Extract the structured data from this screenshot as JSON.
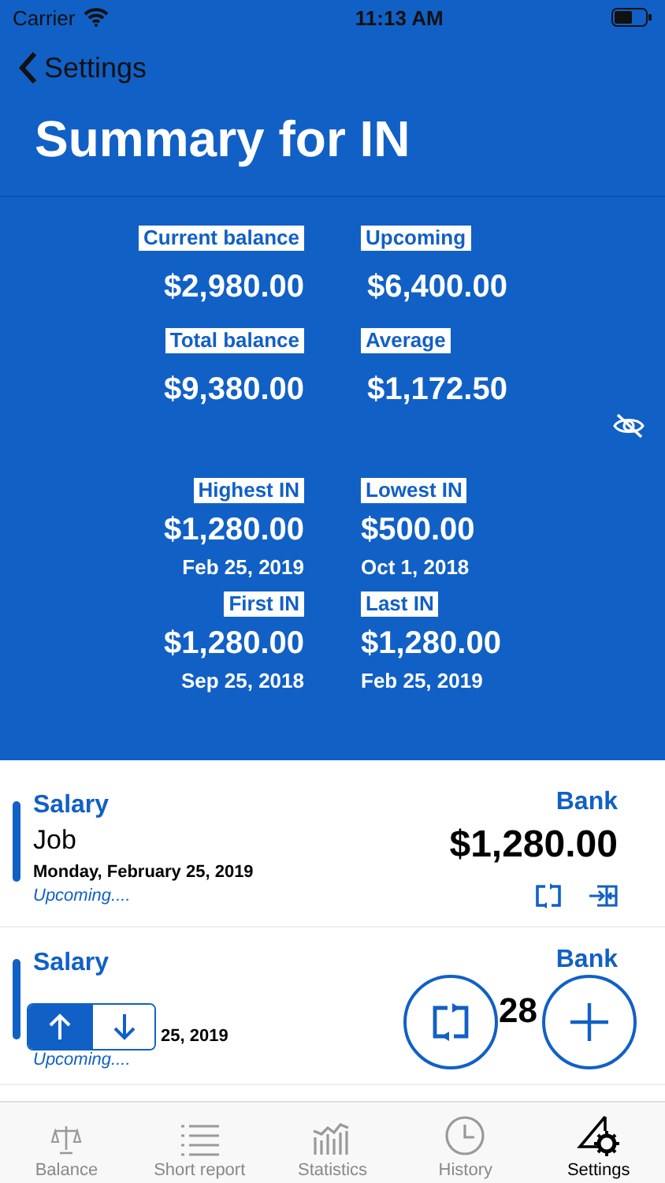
{
  "status_bar": {
    "carrier": "Carrier",
    "time": "11:13 AM"
  },
  "nav": {
    "back": "Settings",
    "title": "Summary for IN"
  },
  "summary_top": [
    {
      "label": "Current balance",
      "value": "$2,980.00"
    },
    {
      "label": "Upcoming",
      "value": "$6,400.00"
    },
    {
      "label": "Total balance",
      "value": "$9,380.00"
    },
    {
      "label": "Average",
      "value": "$1,172.50"
    }
  ],
  "summary_records": [
    {
      "label": "Highest IN",
      "value": "$1,280.00",
      "date": "Feb 25, 2019"
    },
    {
      "label": "Lowest IN",
      "value": "$500.00",
      "date": "Oct 1, 2018"
    },
    {
      "label": "First IN",
      "value": "$1,280.00",
      "date": "Sep 25, 2018"
    },
    {
      "label": "Last IN",
      "value": "$1,280.00",
      "date": "Feb 25, 2019"
    }
  ],
  "entries": [
    {
      "category": "Salary",
      "description": "Job",
      "date": "Monday, February 25, 2019",
      "status": "Upcoming....",
      "account": "Bank",
      "amount": "$1,280.00",
      "covered": false
    },
    {
      "category": "Salary",
      "date": "25, 2019",
      "status": "Upcoming....",
      "account": "Bank",
      "amount": "28",
      "covered": true
    }
  ],
  "sort_control": [
    {
      "kind": "up",
      "selected": true
    },
    {
      "kind": "down",
      "selected": false
    }
  ],
  "fab": [
    {
      "kind": "transfer"
    },
    {
      "kind": "add"
    }
  ],
  "tabs": [
    {
      "kind": "balance",
      "label": "Balance",
      "selected": false
    },
    {
      "kind": "report",
      "label": "Short report",
      "selected": false
    },
    {
      "kind": "statistics",
      "label": "Statistics",
      "selected": false
    },
    {
      "kind": "history",
      "label": "History",
      "selected": false
    },
    {
      "kind": "settings",
      "label": "Settings",
      "selected": true
    }
  ]
}
